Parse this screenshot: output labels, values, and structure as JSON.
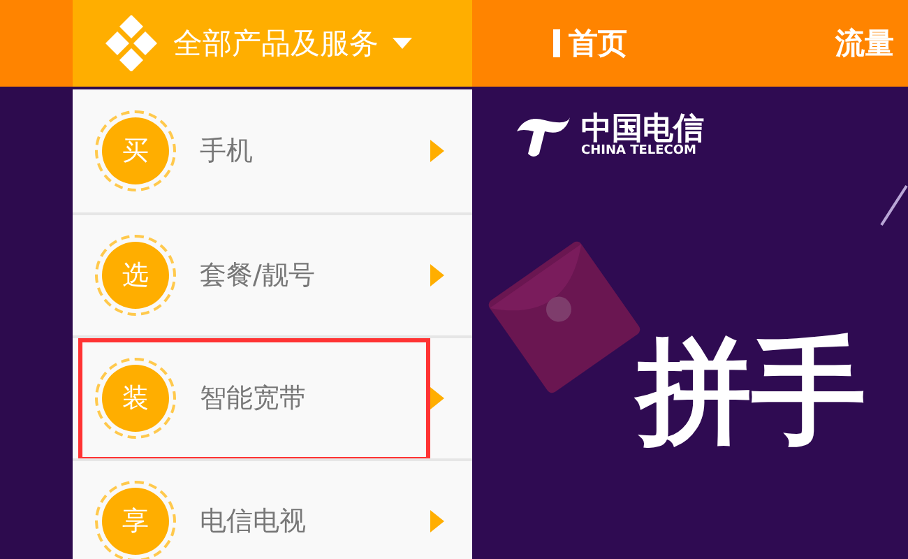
{
  "top_bar": {
    "category_menu": {
      "label": "全部产品及服务",
      "expanded": true
    },
    "nav": [
      {
        "label": "首页",
        "selected": true
      },
      {
        "label": "流量",
        "selected": false
      }
    ]
  },
  "category_items": [
    {
      "badge": "买",
      "label": "手机",
      "highlighted": false
    },
    {
      "badge": "选",
      "label": "套餐/靓号",
      "highlighted": false
    },
    {
      "badge": "装",
      "label": "智能宽带",
      "highlighted": true
    },
    {
      "badge": "享",
      "label": "电信电视",
      "highlighted": false
    }
  ],
  "banner": {
    "logo": {
      "name": "中国电信",
      "english": "CHINA TELECOM"
    },
    "headline": "拼手"
  }
}
